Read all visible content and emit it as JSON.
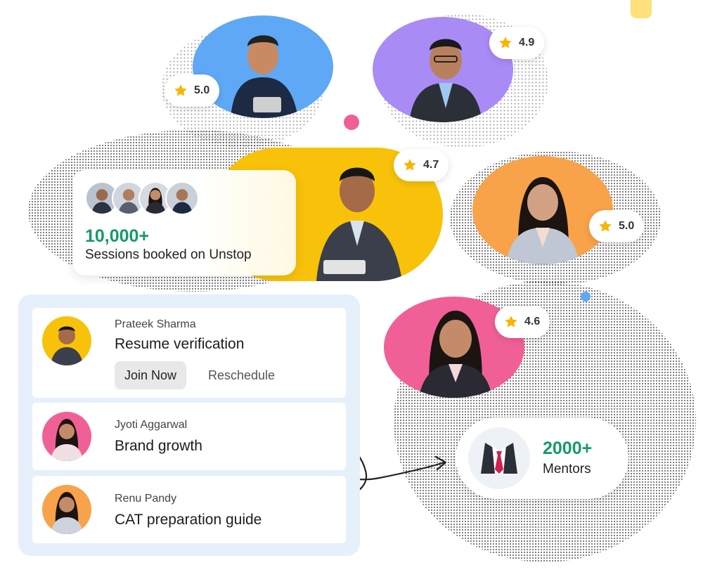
{
  "mentors_top": [
    {
      "name": "mentor-1",
      "rating": "5.0",
      "bg": "#5ea8f5"
    },
    {
      "name": "mentor-2",
      "rating": "4.9",
      "bg": "#a98bf6"
    },
    {
      "name": "mentor-3",
      "rating": "4.7",
      "bg": "#f8c20a"
    },
    {
      "name": "mentor-4",
      "rating": "5.0",
      "bg": "#f8a24a"
    },
    {
      "name": "mentor-5",
      "rating": "4.6",
      "bg": "#f06096"
    }
  ],
  "sessions_card": {
    "count": "10,000+",
    "text": "Sessions booked on Unstop"
  },
  "sessions": [
    {
      "mentor": "Prateek Sharma",
      "title": "Resume verification",
      "avatar_bg": "#f8c20a"
    },
    {
      "mentor": "Jyoti Aggarwal",
      "title": "Brand growth",
      "avatar_bg": "#f06096"
    },
    {
      "mentor": "Renu Pandy",
      "title": "CAT preparation guide",
      "avatar_bg": "#f8a24a"
    }
  ],
  "actions": {
    "join_label": "Join Now",
    "reschedule_label": "Reschedule"
  },
  "mentors_card": {
    "count": "2000+",
    "label": "Mentors"
  },
  "colors": {
    "accent_green": "#159a6b",
    "panel_bg": "#e5f0fb",
    "star": "#f7b500",
    "pink_dot": "#f06096",
    "blue_dot": "#5ea8f5"
  },
  "icons": [
    "star-icon",
    "suit-tie-icon"
  ]
}
